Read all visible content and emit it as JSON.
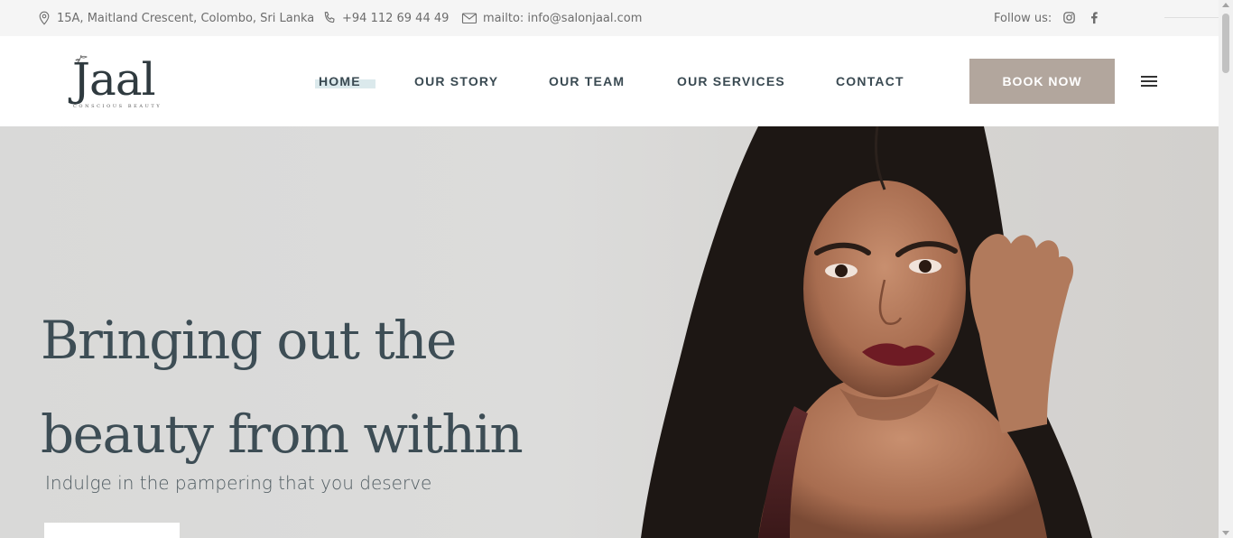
{
  "topbar": {
    "address": "15A, Maitland Crescent, Colombo, Sri Lanka",
    "address_icon": "map-pin-icon",
    "phone": "+94 112 69 44 49",
    "phone_icon": "phone-icon",
    "email": "mailto: info@salonjaal.com",
    "email_icon": "mail-icon",
    "follow_label": "Follow us:",
    "social": [
      "instagram-icon",
      "facebook-icon"
    ]
  },
  "header": {
    "logo_text": "Jaal",
    "logo_tagline": "CONSCIOUS BEAUTY",
    "nav": {
      "home": "HOME",
      "story": "OUR STORY",
      "team": "OUR TEAM",
      "services": "OUR SERVICES",
      "contact": "CONTACT"
    },
    "book_button": "BOOK NOW",
    "menu_icon": "hamburger-menu-icon"
  },
  "hero": {
    "title_line1": "Bringing out the",
    "title_line2": "beauty from within",
    "subtitle": "Indulge in the pampering that you deserve"
  },
  "colors": {
    "accent": "#b2a69d",
    "heading": "#3d4d55",
    "topbar_bg": "#f5f5f5",
    "hero_bg": "#dcdcdb",
    "home_highlight": "#dbe9ec"
  }
}
